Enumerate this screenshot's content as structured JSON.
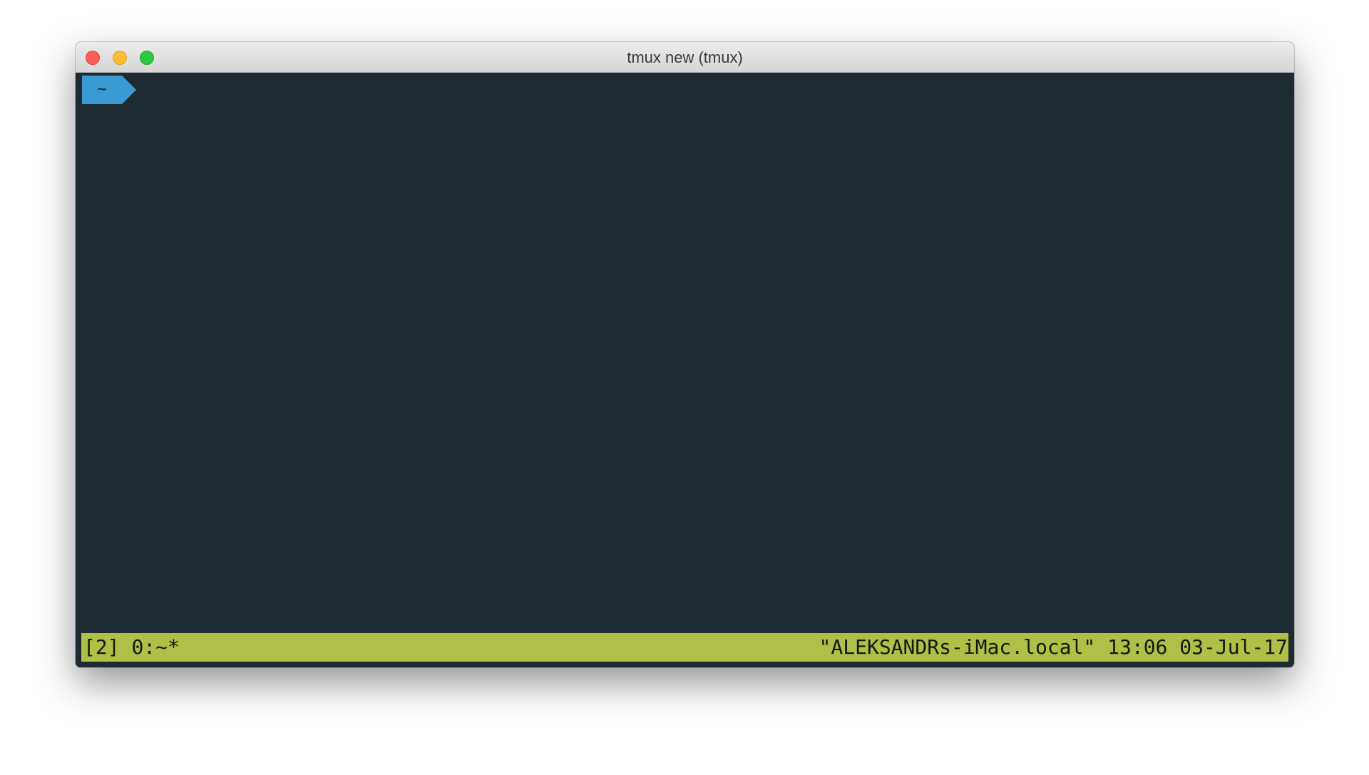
{
  "window": {
    "title": "tmux new (tmux)"
  },
  "colors": {
    "terminal_bg": "#1e2b33",
    "prompt_segment": "#3a9ad3",
    "statusbar_bg": "#b0bf46",
    "close": "#fd5f57",
    "minimize": "#fdbc2e",
    "zoom": "#29c840"
  },
  "prompt": {
    "directory": "~"
  },
  "statusbar": {
    "session": "[2]",
    "window_list": "0:~*",
    "hostname": "\"ALEKSANDRs-iMac.local\"",
    "time": "13:06",
    "date": "03-Jul-17"
  },
  "icons": [
    "close-icon",
    "minimize-icon",
    "zoom-icon",
    "powerline-arrow-icon"
  ]
}
